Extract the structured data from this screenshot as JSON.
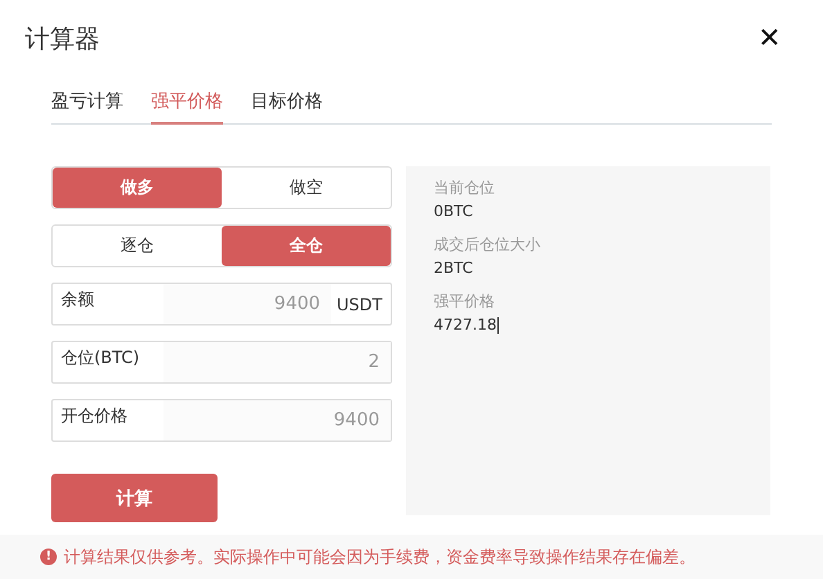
{
  "dialog": {
    "title": "计算器",
    "close": "✕"
  },
  "tabs": [
    {
      "label": "盈亏计算",
      "selected": false
    },
    {
      "label": "强平价格",
      "selected": true
    },
    {
      "label": "目标价格",
      "selected": false
    }
  ],
  "direction": [
    {
      "label": "做多",
      "selected": true
    },
    {
      "label": "做空",
      "selected": false
    }
  ],
  "margin_mode": [
    {
      "label": "逐仓",
      "selected": false
    },
    {
      "label": "全仓",
      "selected": true
    }
  ],
  "fields": [
    {
      "label": "余额",
      "value": "9400",
      "unit": "USDT"
    },
    {
      "label": "仓位(BTC)",
      "value": "2"
    },
    {
      "label": "开仓价格",
      "value": "9400"
    }
  ],
  "calculate_button": "计算",
  "results": [
    {
      "label": "当前仓位",
      "value": "0BTC"
    },
    {
      "label": "成交后仓位大小",
      "value": "2BTC"
    },
    {
      "label": "强平价格",
      "value": "4727.18"
    }
  ],
  "notice": {
    "icon": "!",
    "text": "计算结果仅供参考。实际操作中可能会因为手续费，资金费率导致操作结果存在偏差。"
  }
}
